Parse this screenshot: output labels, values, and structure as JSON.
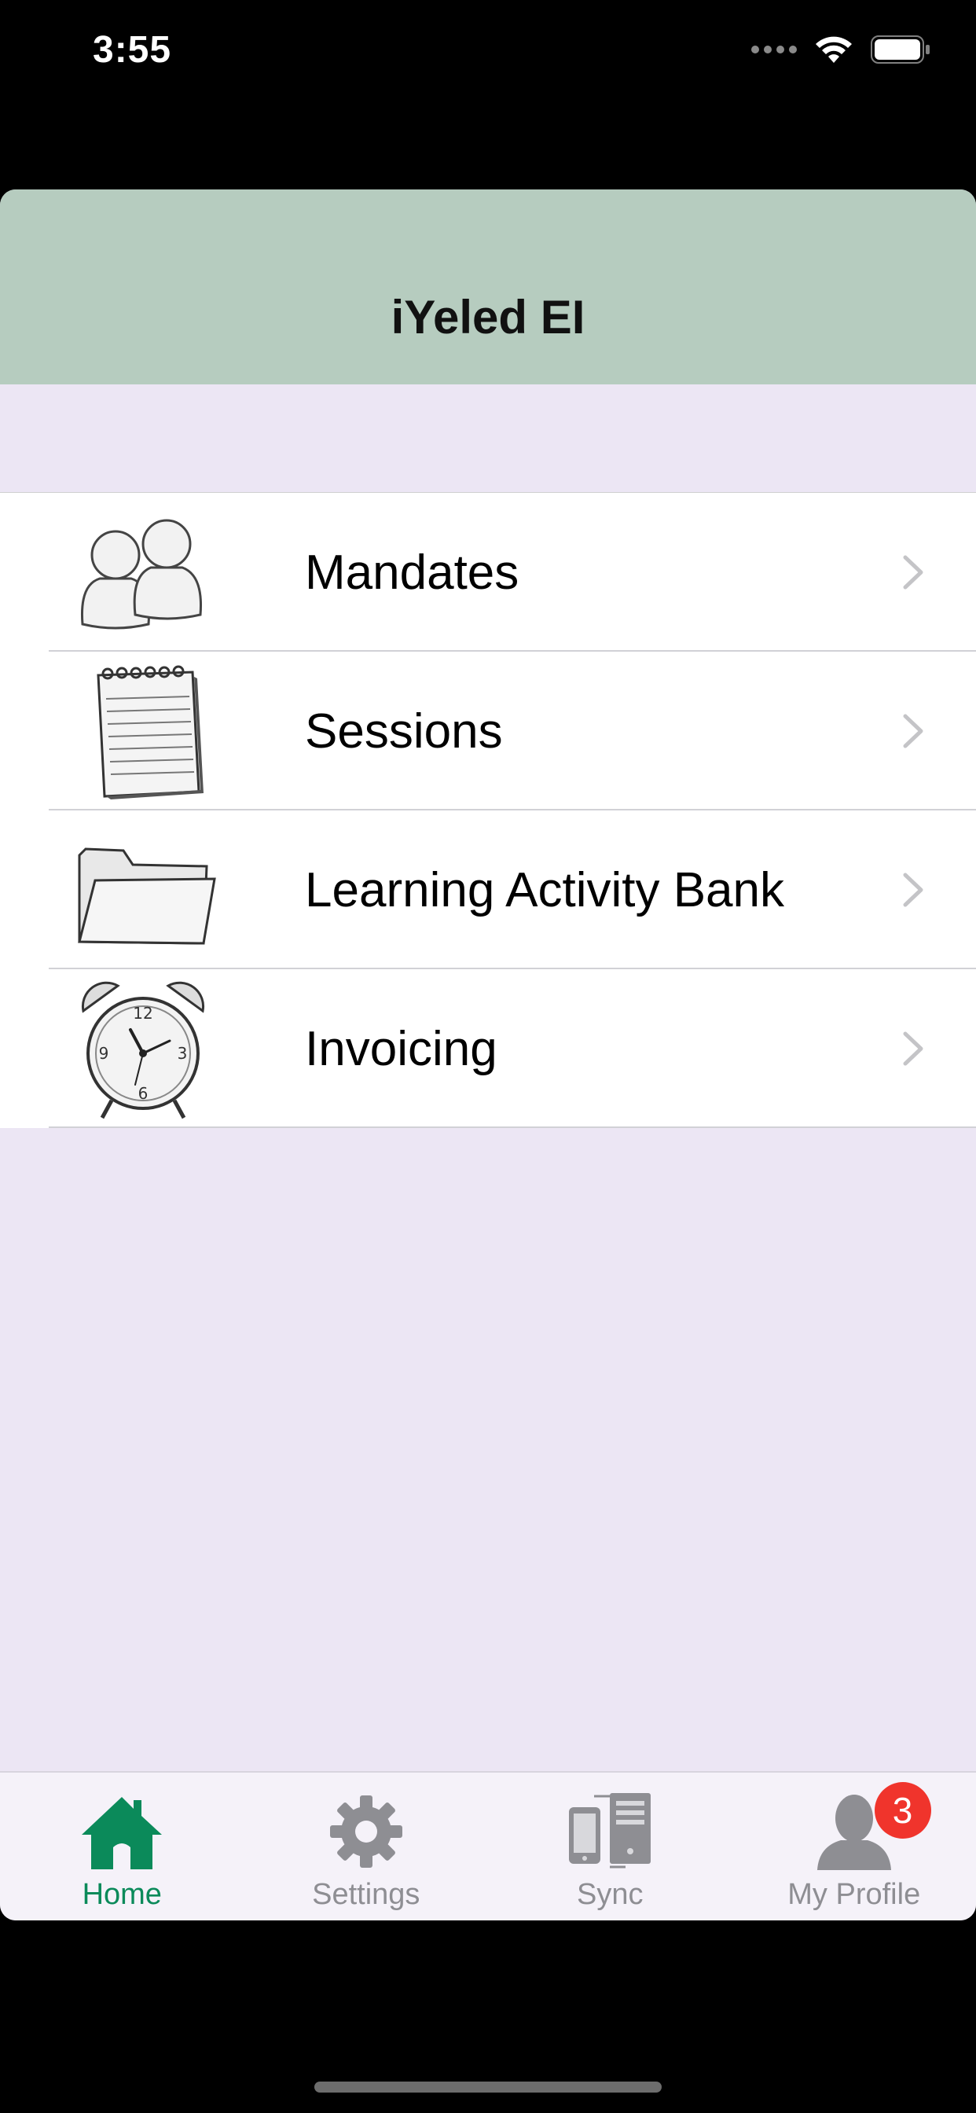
{
  "status_bar": {
    "time": "3:55"
  },
  "nav": {
    "title": "iYeled EI"
  },
  "menu": [
    {
      "label": "Mandates",
      "icon": "people-icon"
    },
    {
      "label": "Sessions",
      "icon": "notepad-icon"
    },
    {
      "label": "Learning Activity Bank",
      "icon": "folder-icon"
    },
    {
      "label": "Invoicing",
      "icon": "alarm-clock-icon"
    }
  ],
  "tabs": [
    {
      "label": "Home",
      "icon": "house-icon",
      "active": true
    },
    {
      "label": "Settings",
      "icon": "gear-icon"
    },
    {
      "label": "Sync",
      "icon": "devices-sync-icon"
    },
    {
      "label": "My Profile",
      "icon": "person-icon",
      "badge": "3"
    }
  ],
  "colors": {
    "nav_background": "#b6ccbf",
    "content_background": "#ece6f4",
    "active_tab": "#0b8a5a",
    "badge": "#f0342c"
  }
}
